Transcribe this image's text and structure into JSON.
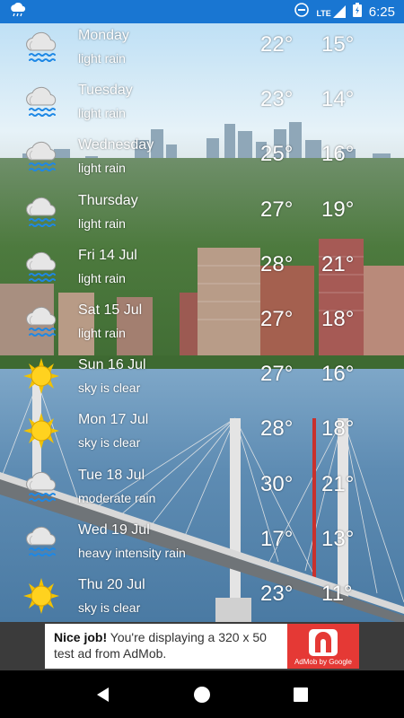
{
  "status_bar": {
    "network": "LTE",
    "time": "6:25"
  },
  "forecast": [
    {
      "day": "Monday",
      "desc": "light rain",
      "hi": "22°",
      "lo": "15°",
      "icon": "rain-cloud-icon"
    },
    {
      "day": "Tuesday",
      "desc": "light rain",
      "hi": "23°",
      "lo": "14°",
      "icon": "rain-cloud-icon"
    },
    {
      "day": "Wednesday",
      "desc": "light rain",
      "hi": "25°",
      "lo": "16°",
      "icon": "rain-cloud-icon"
    },
    {
      "day": "Thursday",
      "desc": "light rain",
      "hi": "27°",
      "lo": "19°",
      "icon": "rain-cloud-icon"
    },
    {
      "day": "Fri 14 Jul",
      "desc": "light rain",
      "hi": "28°",
      "lo": "21°",
      "icon": "rain-cloud-icon"
    },
    {
      "day": "Sat 15 Jul",
      "desc": "light rain",
      "hi": "27°",
      "lo": "18°",
      "icon": "rain-cloud-icon"
    },
    {
      "day": "Sun 16 Jul",
      "desc": "sky is clear",
      "hi": "27°",
      "lo": "16°",
      "icon": "sun-icon"
    },
    {
      "day": "Mon 17 Jul",
      "desc": "sky is clear",
      "hi": "28°",
      "lo": "18°",
      "icon": "sun-icon"
    },
    {
      "day": "Tue 18 Jul",
      "desc": "moderate rain",
      "hi": "30°",
      "lo": "21°",
      "icon": "rain-cloud-icon"
    },
    {
      "day": "Wed 19 Jul",
      "desc": "heavy intensity rain",
      "hi": "17°",
      "lo": "13°",
      "icon": "rain-cloud-icon"
    },
    {
      "day": "Thu 20 Jul",
      "desc": "sky is clear",
      "hi": "23°",
      "lo": "11°",
      "icon": "sun-icon"
    }
  ],
  "ad": {
    "headline": "Nice job!",
    "body": "You're displaying a 320 x 50 test ad from AdMob.",
    "logo_caption": "AdMob by Google"
  },
  "colors": {
    "status_bar": "#1976d2",
    "ad_logo": "#e53935"
  }
}
